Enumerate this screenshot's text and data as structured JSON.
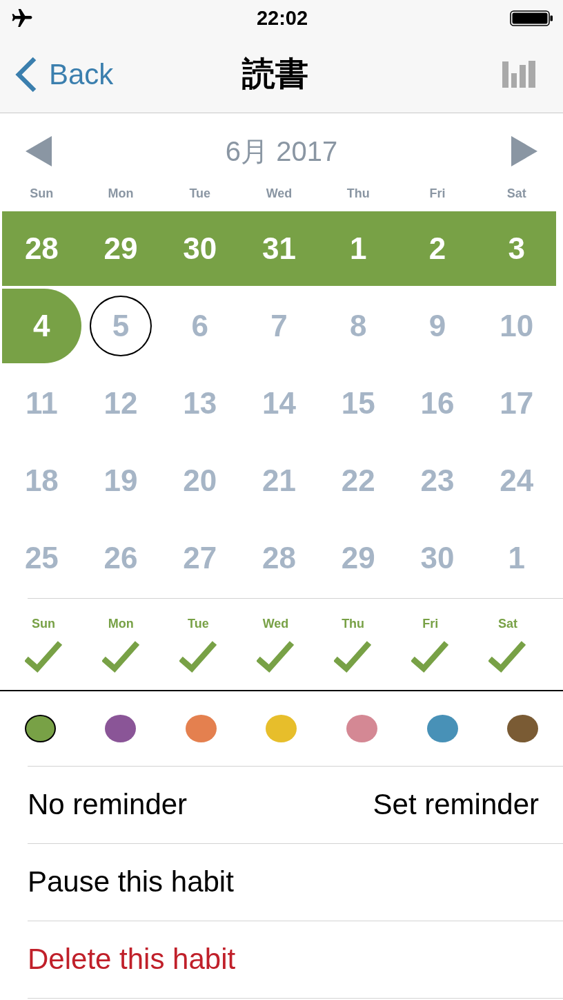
{
  "status_bar": {
    "time": "22:02"
  },
  "nav_bar": {
    "back": "Back",
    "title": "読書"
  },
  "calendar": {
    "month": "6月 2017",
    "weekdays": [
      "Sun",
      "Mon",
      "Tue",
      "Wed",
      "Thu",
      "Fri",
      "Sat"
    ],
    "weeks": [
      [
        {
          "day": "28",
          "done": true,
          "today": false
        },
        {
          "day": "29",
          "done": true,
          "today": false
        },
        {
          "day": "30",
          "done": true,
          "today": false
        },
        {
          "day": "31",
          "done": true,
          "today": false
        },
        {
          "day": "1",
          "done": true,
          "today": false
        },
        {
          "day": "2",
          "done": true,
          "today": false
        },
        {
          "day": "3",
          "done": true,
          "today": false
        }
      ],
      [
        {
          "day": "4",
          "done": true,
          "today": false
        },
        {
          "day": "5",
          "done": false,
          "today": true
        },
        {
          "day": "6",
          "done": false,
          "today": false
        },
        {
          "day": "7",
          "done": false,
          "today": false
        },
        {
          "day": "8",
          "done": false,
          "today": false
        },
        {
          "day": "9",
          "done": false,
          "today": false
        },
        {
          "day": "10",
          "done": false,
          "today": false
        }
      ],
      [
        {
          "day": "11",
          "done": false,
          "today": false
        },
        {
          "day": "12",
          "done": false,
          "today": false
        },
        {
          "day": "13",
          "done": false,
          "today": false
        },
        {
          "day": "14",
          "done": false,
          "today": false
        },
        {
          "day": "15",
          "done": false,
          "today": false
        },
        {
          "day": "16",
          "done": false,
          "today": false
        },
        {
          "day": "17",
          "done": false,
          "today": false
        }
      ],
      [
        {
          "day": "18",
          "done": false,
          "today": false
        },
        {
          "day": "19",
          "done": false,
          "today": false
        },
        {
          "day": "20",
          "done": false,
          "today": false
        },
        {
          "day": "21",
          "done": false,
          "today": false
        },
        {
          "day": "22",
          "done": false,
          "today": false
        },
        {
          "day": "23",
          "done": false,
          "today": false
        },
        {
          "day": "24",
          "done": false,
          "today": false
        }
      ],
      [
        {
          "day": "25",
          "done": false,
          "today": false
        },
        {
          "day": "26",
          "done": false,
          "today": false
        },
        {
          "day": "27",
          "done": false,
          "today": false
        },
        {
          "day": "28",
          "done": false,
          "today": false
        },
        {
          "day": "29",
          "done": false,
          "today": false
        },
        {
          "day": "30",
          "done": false,
          "today": false
        },
        {
          "day": "1",
          "done": false,
          "today": false
        }
      ]
    ]
  },
  "schedule": [
    {
      "day": "Sun",
      "checked": true
    },
    {
      "day": "Mon",
      "checked": true
    },
    {
      "day": "Tue",
      "checked": true
    },
    {
      "day": "Wed",
      "checked": true
    },
    {
      "day": "Thu",
      "checked": true
    },
    {
      "day": "Fri",
      "checked": true
    },
    {
      "day": "Sat",
      "checked": true
    }
  ],
  "colors": [
    {
      "color": "#78a146",
      "selected": true
    },
    {
      "color": "#8a5597",
      "selected": false
    },
    {
      "color": "#e4804f",
      "selected": false
    },
    {
      "color": "#e7be2b",
      "selected": false
    },
    {
      "color": "#d48894",
      "selected": false
    },
    {
      "color": "#4891b7",
      "selected": false
    },
    {
      "color": "#7a5b34",
      "selected": false
    }
  ],
  "reminder": {
    "label": "No reminder",
    "action": "Set reminder"
  },
  "actions": [
    {
      "label": "Pause this habit",
      "kind": "default"
    },
    {
      "label": "Delete this habit",
      "kind": "destructive"
    }
  ]
}
